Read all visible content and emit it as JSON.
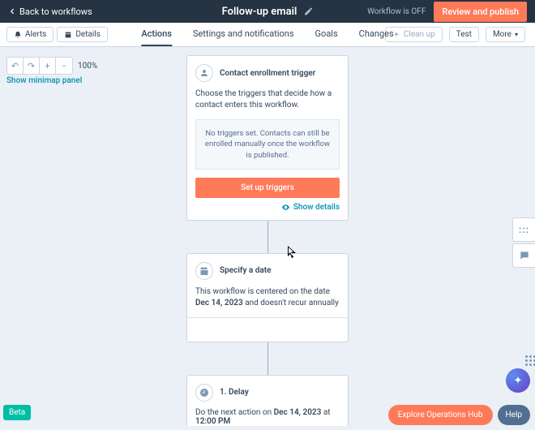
{
  "header": {
    "back": "Back to workflows",
    "title": "Follow-up email",
    "status": "Workflow is OFF",
    "publish": "Review and publish"
  },
  "toolbar": {
    "alerts": "Alerts",
    "details": "Details",
    "cleanup": "Clean up",
    "test": "Test",
    "more": "More"
  },
  "tabs": {
    "actions": "Actions",
    "settings": "Settings and notifications",
    "goals": "Goals",
    "changes": "Changes"
  },
  "zoom": {
    "pct": "100%",
    "minimap": "Show minimap panel"
  },
  "enroll": {
    "title": "Contact enrollment trigger",
    "desc": "Choose the triggers that decide how a contact enters this workflow.",
    "empty": "No triggers set. Contacts can still be enrolled manually once the workflow is published.",
    "cta": "Set up triggers",
    "show": "Show details"
  },
  "date": {
    "title": "Specify a date",
    "pre": "This workflow is centered on the date ",
    "bold": "Dec 14, 2023",
    "post": " and doesn't recur annually"
  },
  "delay": {
    "title": "1. Delay",
    "pre": "Do the next action on ",
    "d": "Dec 14, 2023",
    "mid": " at ",
    "t": "12:00 PM"
  },
  "footer": {
    "beta": "Beta",
    "explore": "Explore Operations Hub",
    "help": "Help"
  }
}
